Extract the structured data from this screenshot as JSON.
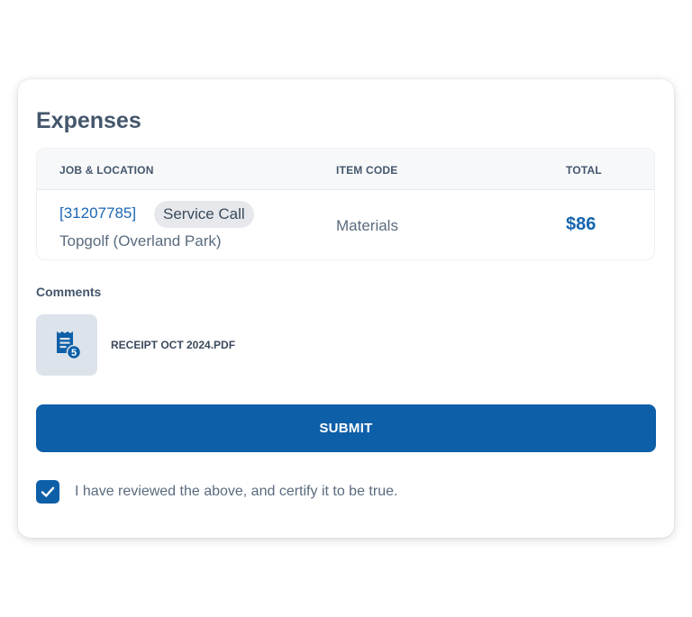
{
  "expenses": {
    "title": "Expenses",
    "table": {
      "columns": [
        "JOB & LOCATION",
        "ITEM CODE",
        "TOTAL"
      ],
      "rows": [
        {
          "job_id": "[31207785]",
          "tag": "Service Call",
          "location": "Topgolf (Overland Park)",
          "item_code": "Materials",
          "total": "$86"
        }
      ]
    },
    "comments_label": "Comments",
    "attachment": {
      "file_name": "RECEIPT OCT 2024.PDF",
      "icon": "receipt-icon",
      "badge": "5"
    },
    "submit_label": "SUBMIT",
    "certify": {
      "checked": true,
      "label": "I have reviewed the above, and certify it to be true."
    }
  },
  "colors": {
    "primary": "#0d5fa8",
    "link": "#1c66b3",
    "heading": "#44566c",
    "muted": "#5a6b7e"
  }
}
